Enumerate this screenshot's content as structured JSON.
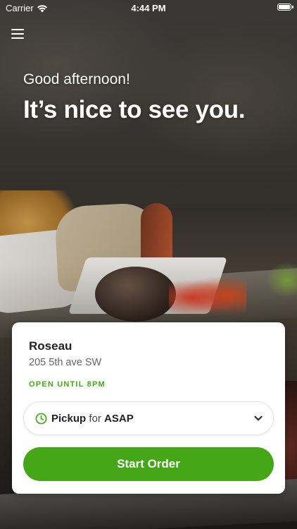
{
  "status_bar": {
    "carrier": "Carrier",
    "time": "4:44 PM"
  },
  "greeting": "Good afternoon!",
  "headline": "It’s nice to see you.",
  "store": {
    "name": "Roseau",
    "address": "205 5th ave SW",
    "hours": "OPEN UNTIL 8PM"
  },
  "pickup": {
    "mode": "Pickup",
    "connector": "for",
    "time": "ASAP"
  },
  "start_order_label": "Start Order",
  "colors": {
    "accent": "#45a617",
    "hours_text": "#49a51a"
  },
  "icons": {
    "wifi": "wifi-icon",
    "battery": "battery-icon",
    "menu": "hamburger-menu-icon",
    "clock": "clock-icon",
    "chevron": "chevron-down-icon"
  }
}
